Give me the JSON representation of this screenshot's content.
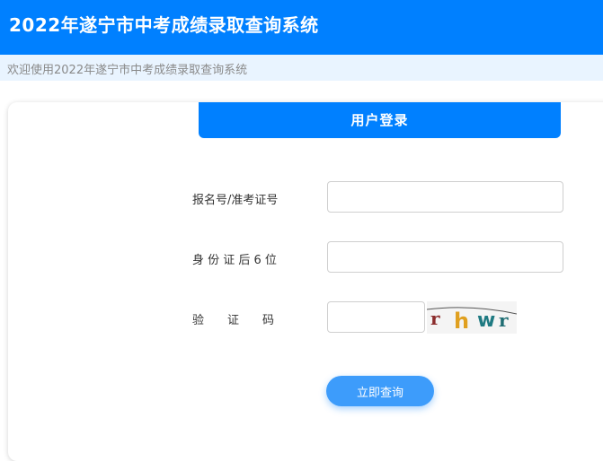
{
  "header": {
    "title": "2022年遂宁市中考成绩录取查询系统",
    "bg_color": "#0080ff"
  },
  "subheader": {
    "welcome": "欢迎使用2022年遂宁市中考成绩录取查询系统"
  },
  "login": {
    "tab_label": "用户登录",
    "fields": [
      {
        "label": "报名号/准考证号",
        "value": "",
        "placeholder": ""
      },
      {
        "label": "身 份 证 后 6 位",
        "value": "",
        "placeholder": ""
      },
      {
        "label": "验　　证　　码",
        "value": "",
        "placeholder": ""
      }
    ],
    "captcha_text": "rhwr",
    "submit_label": "立即查询"
  }
}
